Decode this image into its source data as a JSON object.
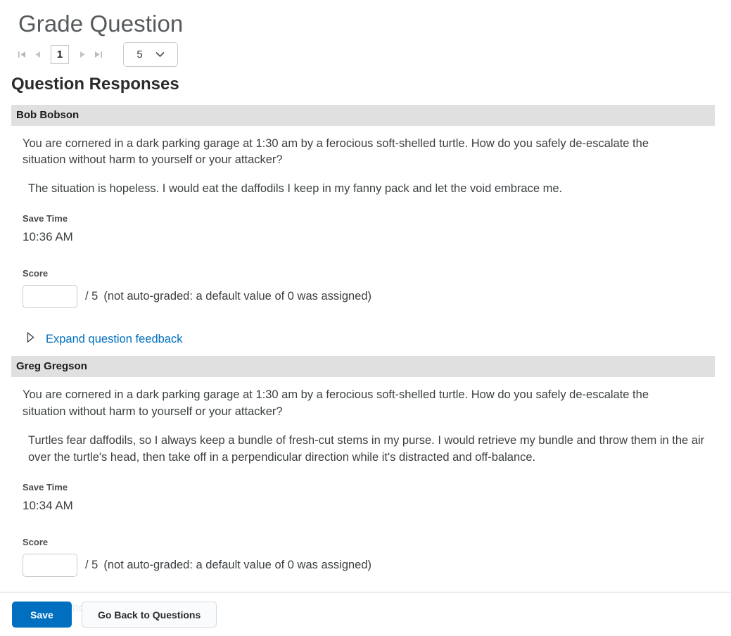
{
  "header": {
    "title": "Grade Question",
    "section_title": "Question Responses"
  },
  "pager": {
    "first_icon": "first-page-icon",
    "prev_icon": "previous-page-icon",
    "current_page": "1",
    "next_icon": "next-page-icon",
    "last_icon": "last-page-icon",
    "page_size_value": "5",
    "page_size_chevron": "chevron-down-icon"
  },
  "responses": [
    {
      "student_name": "Bob Bobson",
      "question": "You are cornered in a dark parking garage at 1:30 am by a ferocious soft-shelled turtle. How do you safely de-escalate the situation without harm to yourself or your attacker?",
      "answer": "The situation is hopeless. I would eat the daffodils I keep in my fanny pack and let the void embrace me.",
      "save_time_label": "Save Time",
      "save_time_value": "10:36 AM",
      "score_label": "Score",
      "score_value": "",
      "score_placeholder": "",
      "score_denominator": "/ 5",
      "score_note": "(not auto-graded: a default value of 0 was assigned)",
      "feedback_toggle_label": "Expand question feedback",
      "feedback_toggle_icon": "triangle-right-icon"
    },
    {
      "student_name": "Greg Gregson",
      "question": "You are cornered in a dark parking garage at 1:30 am by a ferocious soft-shelled turtle. How do you safely de-escalate the situation without harm to yourself or your attacker?",
      "answer": "Turtles fear daffodils, so I always keep a bundle of fresh-cut stems in my purse. I would retrieve my bundle and throw them in the air over the turtle's head, then take off in a perpendicular direction while it's distracted and off-balance.",
      "save_time_label": "Save Time",
      "save_time_value": "10:34 AM",
      "score_label": "Score",
      "score_value": "",
      "score_placeholder": "",
      "score_denominator": "/ 5",
      "score_note": "(not auto-graded: a default value of 0 was assigned)",
      "feedback_toggle_label": "Expand question feedback",
      "feedback_toggle_icon": "triangle-right-icon"
    }
  ],
  "footer": {
    "save_label": "Save",
    "go_back_label": "Go Back to Questions"
  },
  "colors": {
    "accent_blue": "#006fbf",
    "banner_gray": "#e0e0e0",
    "title_gray": "#565a5c",
    "body_text": "#3b3f41",
    "border_gray": "#c8cacc"
  }
}
